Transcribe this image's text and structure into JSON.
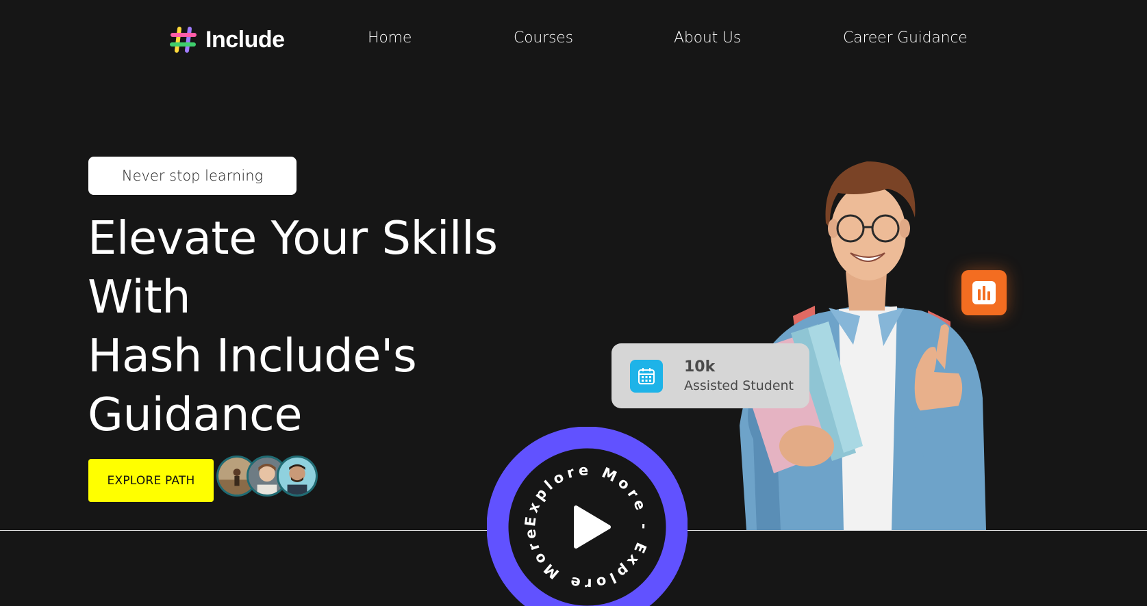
{
  "brand": {
    "name": "Include",
    "accent": "#ffff00",
    "ring_color": "#6152ff"
  },
  "nav": {
    "items": [
      {
        "label": "Home"
      },
      {
        "label": "Courses"
      },
      {
        "label": "About Us"
      },
      {
        "label": "Career Guidance"
      }
    ]
  },
  "hero": {
    "tagline": "Never stop learning",
    "headline_lines": [
      "Elevate Your Skills",
      "With",
      "Hash Include's",
      "Guidance"
    ],
    "cta_label": "EXPLORE PATH",
    "avatar_count": 3
  },
  "explore_badge": {
    "ring_text": "Explore More - Explore More - ",
    "icon": "play-icon"
  },
  "stat_card": {
    "value": "10k",
    "label": "Assisted Student",
    "icon": "calendar-icon",
    "icon_color": "#1eb3e8"
  },
  "chart_badge": {
    "icon": "bar-chart-icon",
    "color": "#f36d21"
  }
}
